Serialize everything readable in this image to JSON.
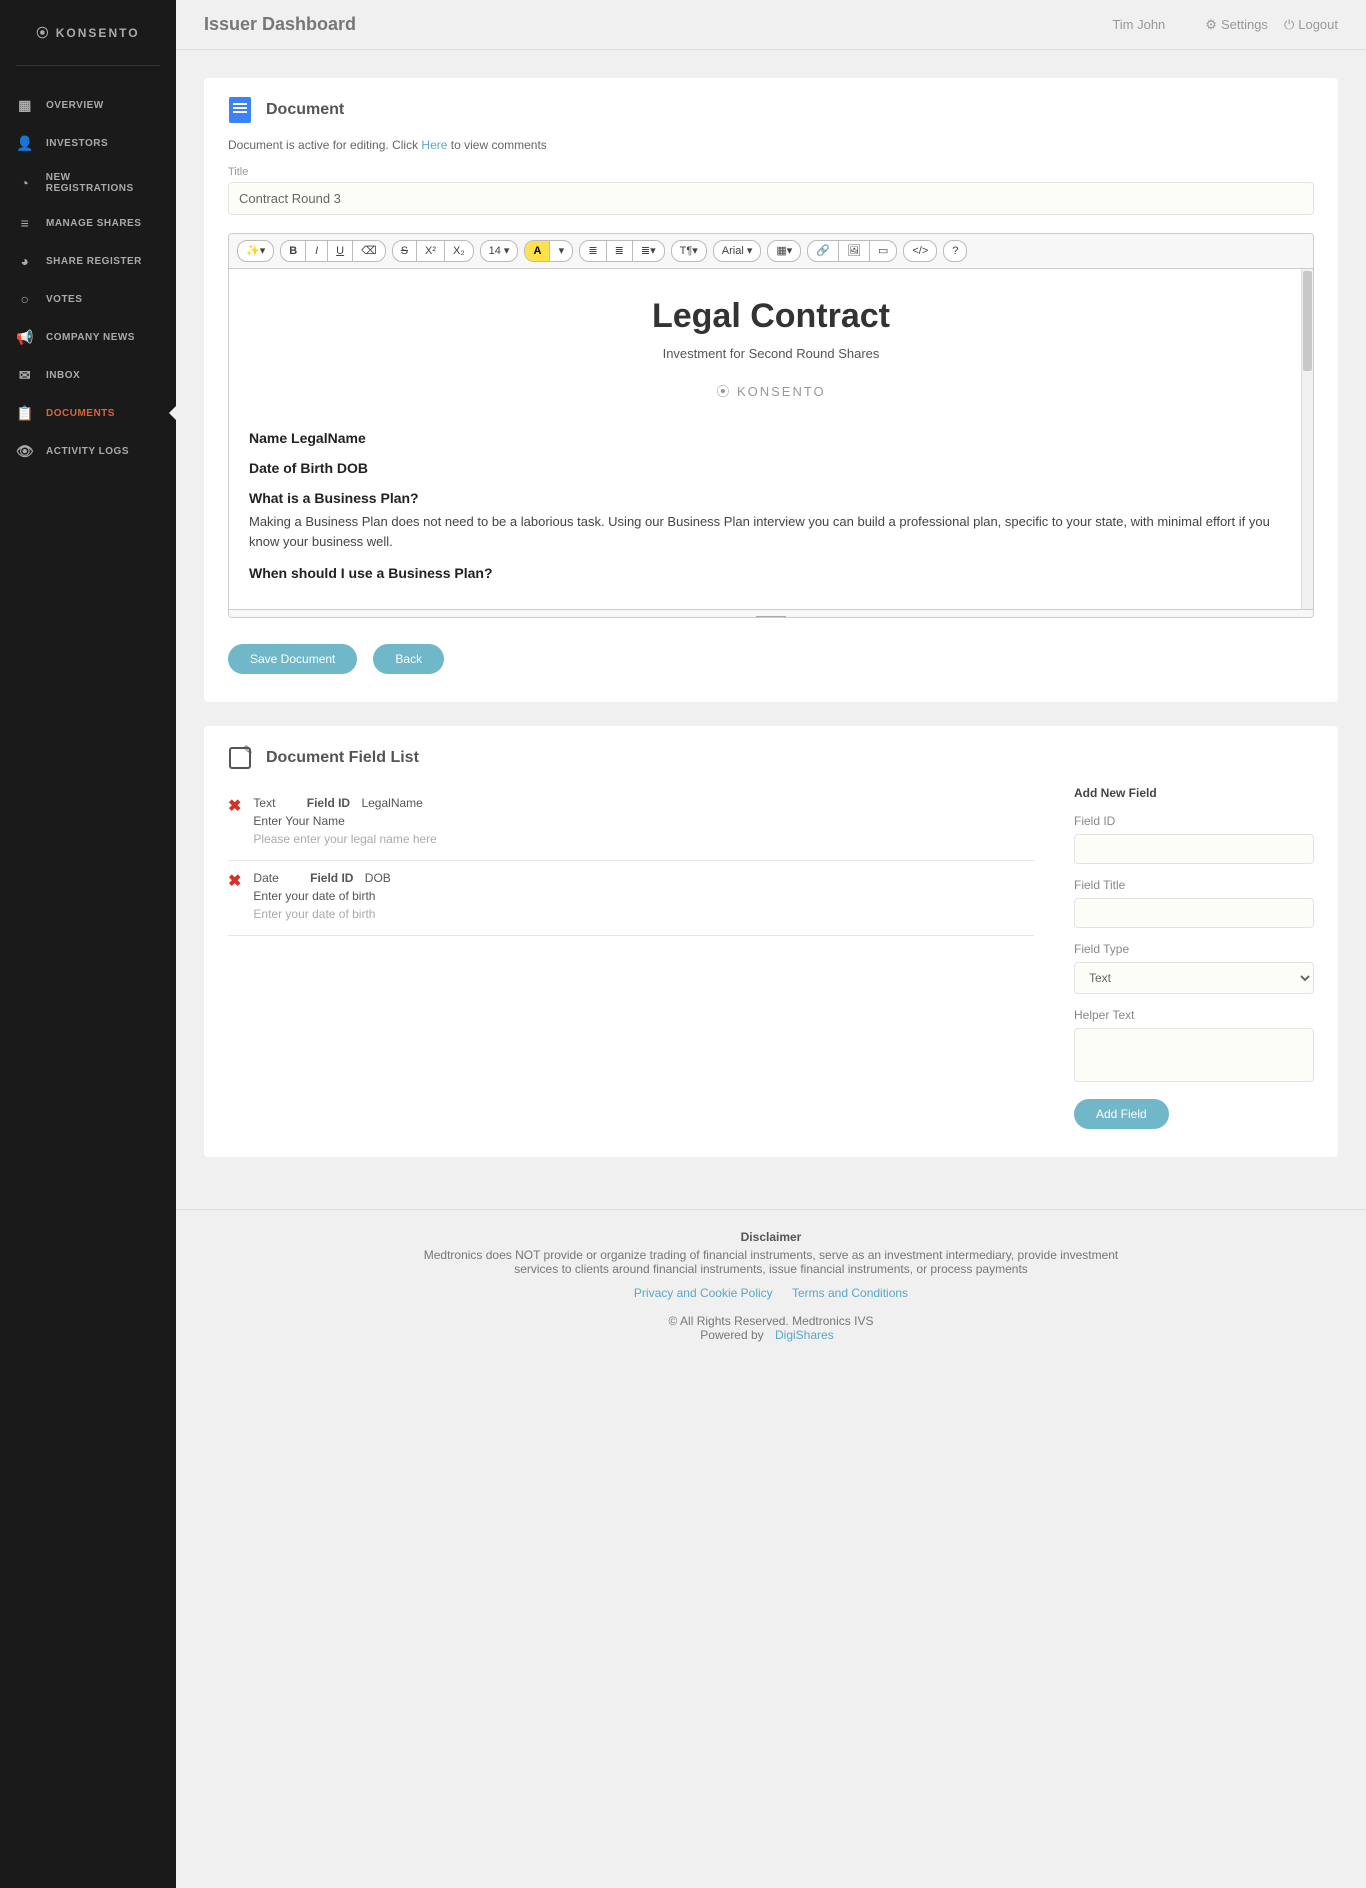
{
  "brand": "KONSENTO",
  "header": {
    "title": "Issuer Dashboard",
    "user": "Tim John",
    "settings": "Settings",
    "logout": "Logout"
  },
  "sidebar": {
    "items": [
      {
        "label": "OVERVIEW",
        "icon": "▦"
      },
      {
        "label": "INVESTORS",
        "icon": "👤"
      },
      {
        "label": "NEW REGISTRATIONS",
        "icon": "◔"
      },
      {
        "label": "MANAGE SHARES",
        "icon": "≡"
      },
      {
        "label": "SHARE REGISTER",
        "icon": "◕"
      },
      {
        "label": "VOTES",
        "icon": "○"
      },
      {
        "label": "COMPANY NEWS",
        "icon": "📢"
      },
      {
        "label": "INBOX",
        "icon": "✉"
      },
      {
        "label": "DOCUMENTS",
        "icon": "📋",
        "active": true
      },
      {
        "label": "ACTIVITY LOGS",
        "icon": "👁"
      }
    ]
  },
  "document_card": {
    "title": "Document",
    "hint_prefix": "Document is active for editing. Click ",
    "hint_link": "Here",
    "hint_suffix": " to view comments",
    "title_label": "Title",
    "title_value": "Contract Round 3",
    "save_btn": "Save Document",
    "back_btn": "Back"
  },
  "toolbar": {
    "magic": "✨▾",
    "bold": "B",
    "italic": "I",
    "underline": "U",
    "erase": "⌫",
    "strike": "S",
    "sup": "X²",
    "sub": "X₂",
    "size": "14 ▾",
    "highlight": "A",
    "hcaret": "▾",
    "ul": "≣",
    "ol": "≣",
    "indent": "≣▾",
    "para": "T¶▾",
    "font": "Arial ▾",
    "table": "▦▾",
    "link": "🔗",
    "img": "🖼",
    "video": "▭",
    "code": "</>",
    "help": "?"
  },
  "editor": {
    "h1": "Legal Contract",
    "sub": "Investment for Second Round Shares",
    "brand_center": "⦿ KONSENTO",
    "name_line_label": "Name ",
    "name_line_field": "LegalName",
    "dob_line_label": "Date of Birth ",
    "dob_line_field": "DOB",
    "q1": "What is a Business Plan?",
    "p1": "Making a Business Plan does not need to be a laborious task. Using our Business Plan interview you can build a professional plan, specific to your state, with minimal effort if you know your business well.",
    "q2": "When should I use a Business Plan?"
  },
  "field_list": {
    "title": "Document Field List",
    "items": [
      {
        "type": "Text",
        "id_label": "Field ID",
        "id": "LegalName",
        "title": "Enter Your Name",
        "helper": "Please enter your legal name here"
      },
      {
        "type": "Date",
        "id_label": "Field ID",
        "id": "DOB",
        "title": "Enter your date of birth",
        "helper": "Enter your date of birth"
      }
    ],
    "add": {
      "heading": "Add New Field",
      "id_label": "Field ID",
      "title_label": "Field Title",
      "type_label": "Field Type",
      "type_value": "Text",
      "helper_label": "Helper Text",
      "button": "Add Field"
    }
  },
  "footer": {
    "disclaimer_title": "Disclaimer",
    "disclaimer_text": "Medtronics does NOT provide or organize trading of financial instruments, serve as an investment intermediary, provide investment services to clients around financial instruments, issue financial instruments, or process payments",
    "privacy": "Privacy and Cookie Policy",
    "terms": "Terms and Conditions",
    "rights": "© All Rights Reserved. Medtronics IVS",
    "powered_prefix": "Powered by ",
    "powered_link": "DigiShares"
  }
}
